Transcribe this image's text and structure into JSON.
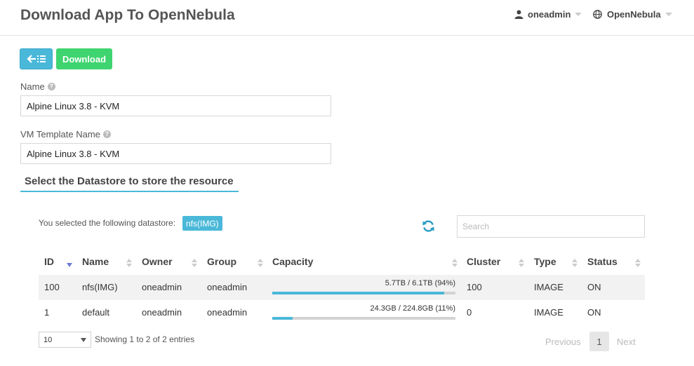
{
  "header": {
    "title": "Download App To OpenNebula",
    "user": "oneadmin",
    "zone": "OpenNebula"
  },
  "toolbar": {
    "back_icon": "arrow-left-list-icon",
    "download_label": "Download"
  },
  "form": {
    "name_label": "Name",
    "name_value": "Alpine Linux 3.8 - KVM",
    "template_label": "VM Template Name",
    "template_value": "Alpine Linux 3.8 - KVM"
  },
  "datastore": {
    "section_title": "Select the Datastore to store the resource",
    "selected_prefix": "You selected the following datastore:",
    "selected_value": "nfs(IMG)",
    "search_placeholder": "Search",
    "columns": [
      "ID",
      "Name",
      "Owner",
      "Group",
      "Capacity",
      "Cluster",
      "Type",
      "Status"
    ],
    "rows": [
      {
        "id": "100",
        "name": "nfs(IMG)",
        "owner": "oneadmin",
        "group": "oneadmin",
        "capacity": "5.7TB / 6.1TB (94%)",
        "capacity_pct": 94,
        "cluster": "100",
        "type": "IMAGE",
        "status": "ON"
      },
      {
        "id": "1",
        "name": "default",
        "owner": "oneadmin",
        "group": "oneadmin",
        "capacity": "24.3GB / 224.8GB (11%)",
        "capacity_pct": 11,
        "cluster": "0",
        "type": "IMAGE",
        "status": "ON"
      }
    ],
    "page_size": "10",
    "showing": "Showing 1 to 2 of 2 entries",
    "previous": "Previous",
    "current_page": "1",
    "next": "Next"
  },
  "colors": {
    "accent": "#4ab8d9",
    "success": "#3ed46f"
  }
}
